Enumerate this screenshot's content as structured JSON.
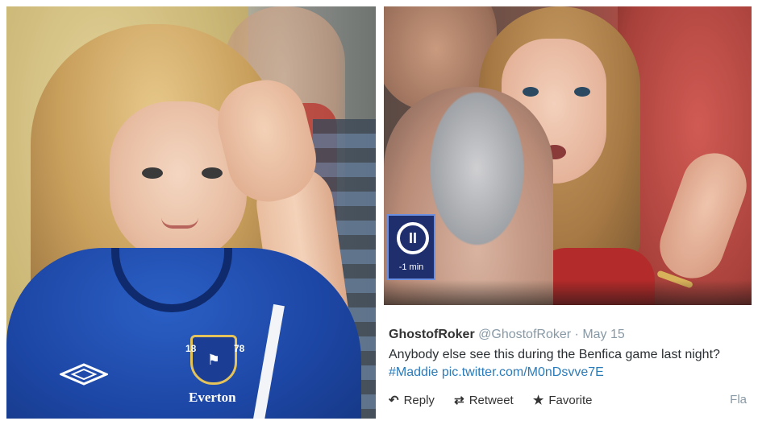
{
  "left_photo": {
    "shirt_brand": "Everton",
    "crest_year_left": "18",
    "crest_year_right": "78",
    "umbro_logo": "umbro-diamond-logo"
  },
  "right_panel": {
    "video": {
      "pause_icon": "pause-icon",
      "timer_label": "-1 min"
    },
    "tweet": {
      "name": "GhostofRoker",
      "handle": "@GhostofRoker",
      "separator": "·",
      "date": "May 15",
      "text": "Anybody else see this during the Benfica game last night?",
      "hashtag": "#Maddie",
      "link": "pic.twitter.com/M0nDsvve7E",
      "actions": {
        "reply": "Reply",
        "retweet": "Retweet",
        "favorite": "Favorite",
        "flag": "Fla"
      }
    }
  },
  "colors": {
    "twitter_link": "#2b7bb9",
    "twitter_gray": "#8899a6",
    "everton_blue": "#1d47a6"
  }
}
